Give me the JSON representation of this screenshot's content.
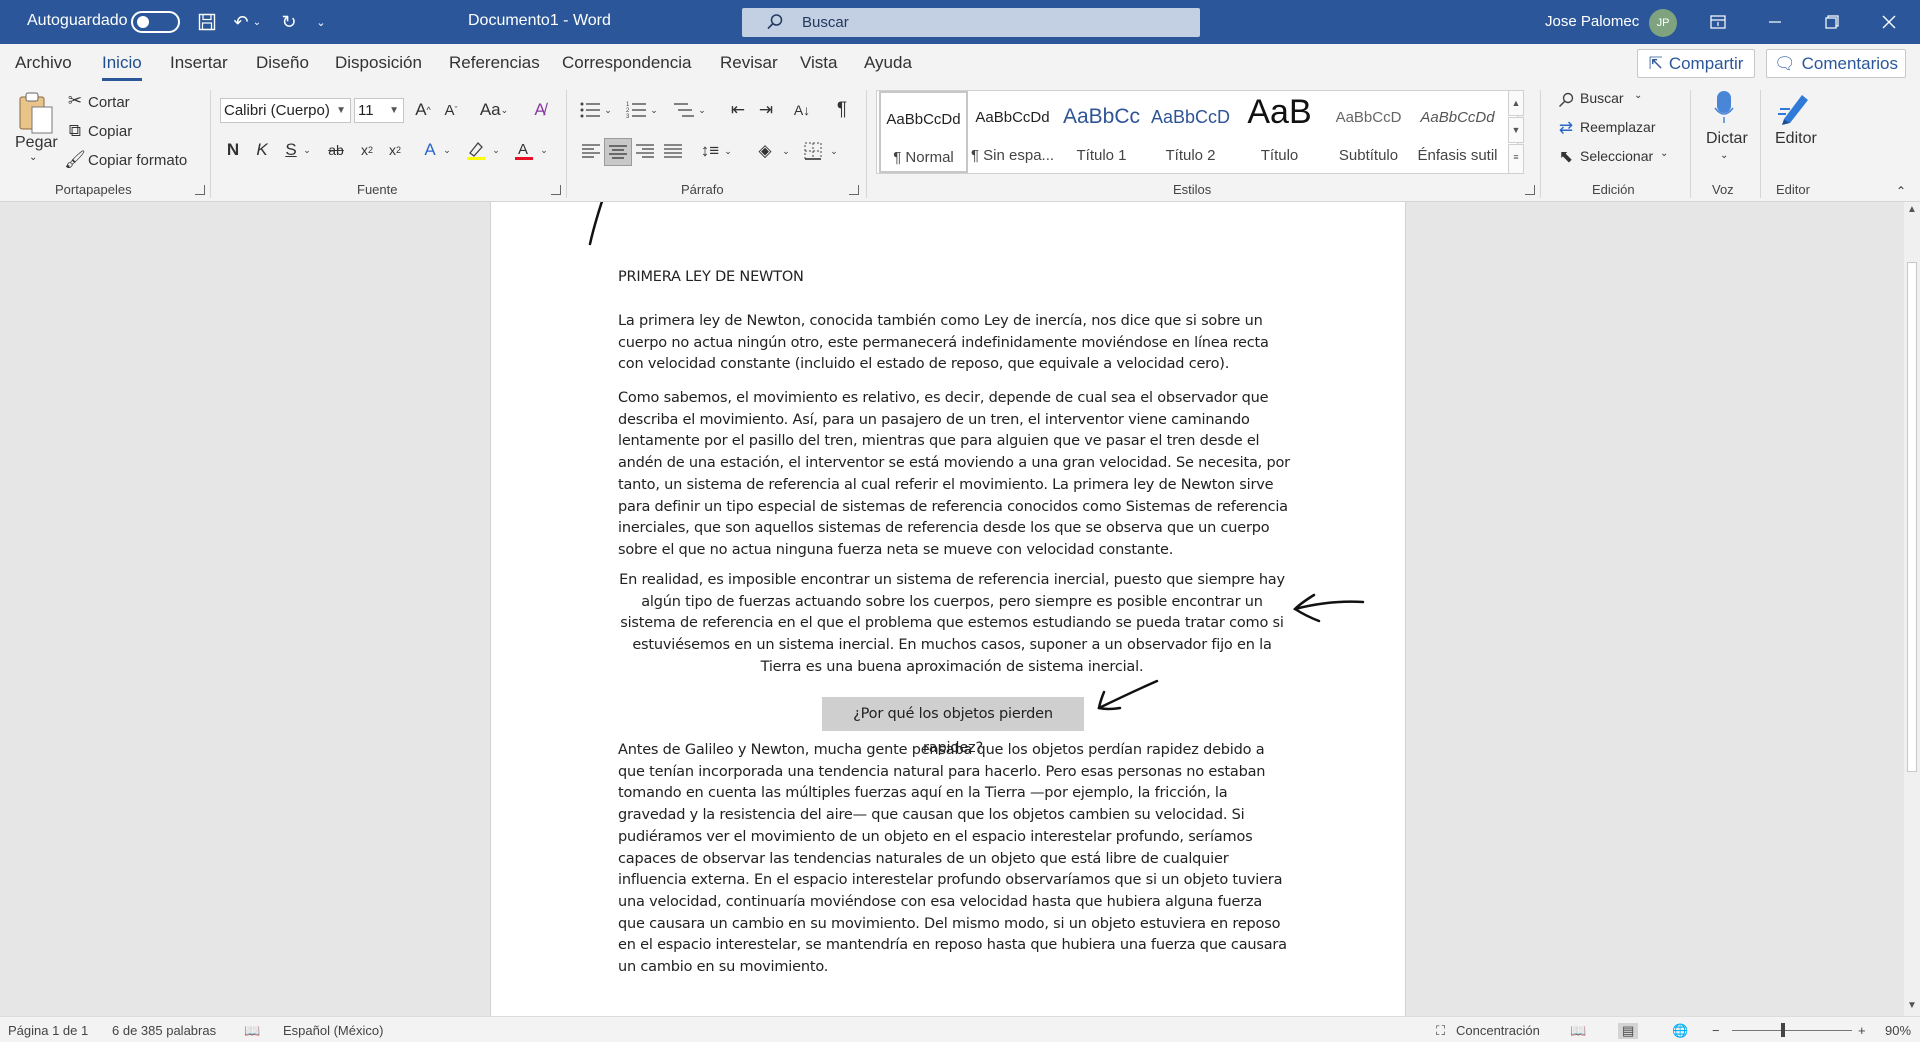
{
  "titlebar": {
    "autosave_label": "Autoguardado",
    "document_title": "Documento1  -  Word",
    "search_placeholder": "Buscar",
    "user_name": "Jose Palomec",
    "user_initials": "JP"
  },
  "tabs": [
    "Archivo",
    "Inicio",
    "Insertar",
    "Diseño",
    "Disposición",
    "Referencias",
    "Correspondencia",
    "Revisar",
    "Vista",
    "Ayuda"
  ],
  "active_tab": "Inicio",
  "share_label": "Compartir",
  "comments_label": "Comentarios",
  "clipboard": {
    "paste": "Pegar",
    "cut": "Cortar",
    "copy": "Copiar",
    "format_painter": "Copiar formato",
    "group": "Portapapeles"
  },
  "font": {
    "name": "Calibri (Cuerpo)",
    "size": "11",
    "group": "Fuente"
  },
  "paragraph": {
    "group": "Párrafo"
  },
  "styles": {
    "group": "Estilos",
    "items": [
      {
        "sample": "AaBbCcDd",
        "name": "¶ Normal"
      },
      {
        "sample": "AaBbCcDd",
        "name": "¶ Sin espa..."
      },
      {
        "sample": "AaBbCc",
        "name": "Título 1"
      },
      {
        "sample": "AaBbCcD",
        "name": "Título 2"
      },
      {
        "sample": "AaB",
        "name": "Título"
      },
      {
        "sample": "AaBbCcD",
        "name": "Subtítulo"
      },
      {
        "sample": "AaBbCcDd",
        "name": "Énfasis sutil"
      }
    ]
  },
  "editing": {
    "find": "Buscar",
    "replace": "Reemplazar",
    "select": "Seleccionar",
    "group": "Edición"
  },
  "voice": {
    "dictate": "Dictar",
    "group": "Voz"
  },
  "editor": {
    "label": "Editor",
    "group": "Editor"
  },
  "document": {
    "title": "PRIMERA LEY DE NEWTON",
    "p1": "La primera ley de Newton, conocida también como Ley de inercía, nos dice que si sobre un cuerpo no actua ningún otro, este permanecerá indefinidamente moviéndose en línea recta con velocidad constante (incluido el estado de reposo, que equivale a velocidad cero).",
    "p2": "Como sabemos, el movimiento es relativo, es decir, depende de cual sea el observador que describa el movimiento. Así, para un pasajero de un tren, el interventor viene caminando lentamente por el pasillo del tren, mientras que para alguien que ve pasar el tren desde el andén de una estación, el interventor se está moviendo a una gran velocidad. Se necesita, por tanto, un sistema de referencia al cual referir el movimiento. La primera ley de Newton sirve para definir un tipo especial de sistemas de referencia conocidos como Sistemas de referencia inerciales, que son aquellos sistemas de referencia desde los que se observa que un cuerpo sobre el que no actua ninguna fuerza neta se mueve con velocidad constante.",
    "p3": "En realidad, es imposible encontrar un sistema de referencia inercial, puesto que siempre hay algún tipo de fuerzas actuando sobre los cuerpos, pero siempre es posible encontrar un sistema de referencia en el que el problema que estemos estudiando se pueda tratar como si estuviésemos en un sistema inercial. En muchos casos, suponer a un observador fijo en la Tierra es una buena aproximación de sistema inercial.",
    "heading": "¿Por qué los objetos pierden rapidez?",
    "p4": "Antes de Galileo y Newton, mucha gente pensaba que los objetos perdían rapidez debido a que tenían incorporada una tendencia natural para hacerlo. Pero esas personas no estaban tomando en cuenta las múltiples fuerzas aquí en la Tierra —por ejemplo, la fricción, la gravedad y la resistencia del aire— que causan que los objetos cambien su velocidad. Si pudiéramos ver el movimiento de un objeto en el espacio interestelar profundo, seríamos capaces de observar las tendencias naturales de un objeto que está libre de cualquier influencia externa. En el espacio interestelar profundo observaríamos que si un objeto tuviera una velocidad, continuaría moviéndose con esa velocidad hasta que hubiera alguna fuerza que causara un cambio en su movimiento. Del mismo modo, si un objeto estuviera en reposo en el espacio interestelar, se mantendría en reposo hasta que hubiera una fuerza que causara un cambio en su movimiento."
  },
  "status": {
    "page": "Página 1 de 1",
    "words": "6 de 385 palabras",
    "language": "Español (México)",
    "focus": "Concentración",
    "zoom": "90%"
  }
}
